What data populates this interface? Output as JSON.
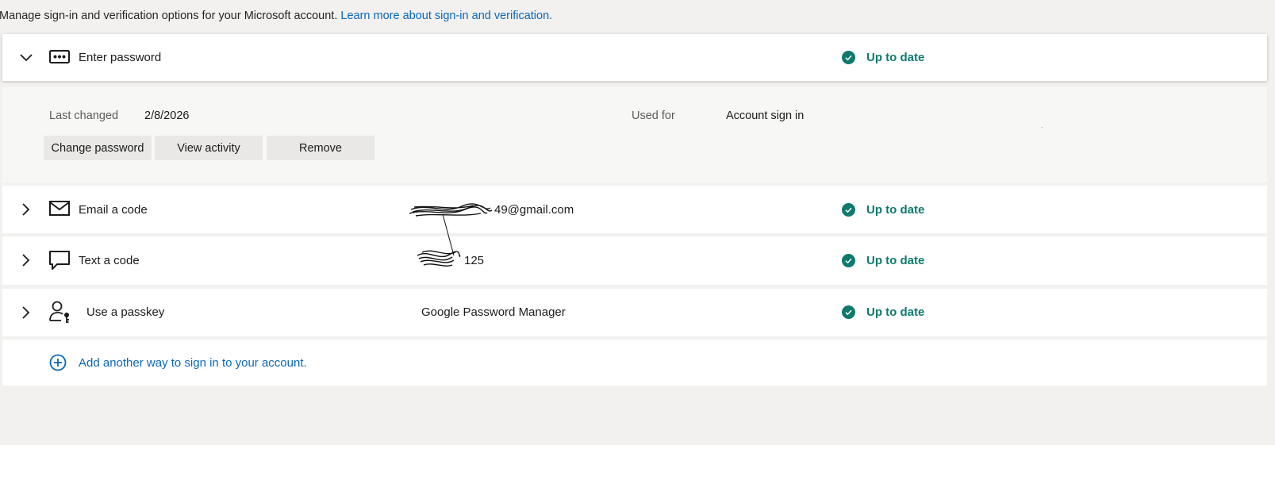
{
  "intro": {
    "text": "Manage sign-in and verification options for your Microsoft account. ",
    "link": "Learn more about sign-in and verification."
  },
  "methods": [
    {
      "label": "Enter password",
      "icon": "password-dots-icon",
      "detail": "",
      "status": "Up to date",
      "expanded": true
    },
    {
      "label": "Email a code",
      "icon": "envelope-icon",
      "detail": "49@gmail.com",
      "status": "Up to date",
      "expanded": false
    },
    {
      "label": "Text a code",
      "icon": "chat-bubble-icon",
      "detail": "125",
      "status": "Up to date",
      "expanded": false
    },
    {
      "label": "Use a passkey",
      "icon": "person-key-icon",
      "detail": "Google Password Manager",
      "status": "Up to date",
      "expanded": false
    }
  ],
  "password_details": {
    "last_changed_label": "Last changed",
    "last_changed_value": "2/8/2026",
    "used_for_label": "Used for",
    "used_for_value": "Account sign in",
    "actions": [
      "Change password",
      "View activity",
      "Remove"
    ]
  },
  "add_method": {
    "label": "Add another way to sign in to your account.",
    "icon": "plus-circle-icon"
  },
  "colors": {
    "accent_link": "#0a67b8",
    "status_green": "#0e7a6d",
    "page_background": "#f2f1ef"
  }
}
